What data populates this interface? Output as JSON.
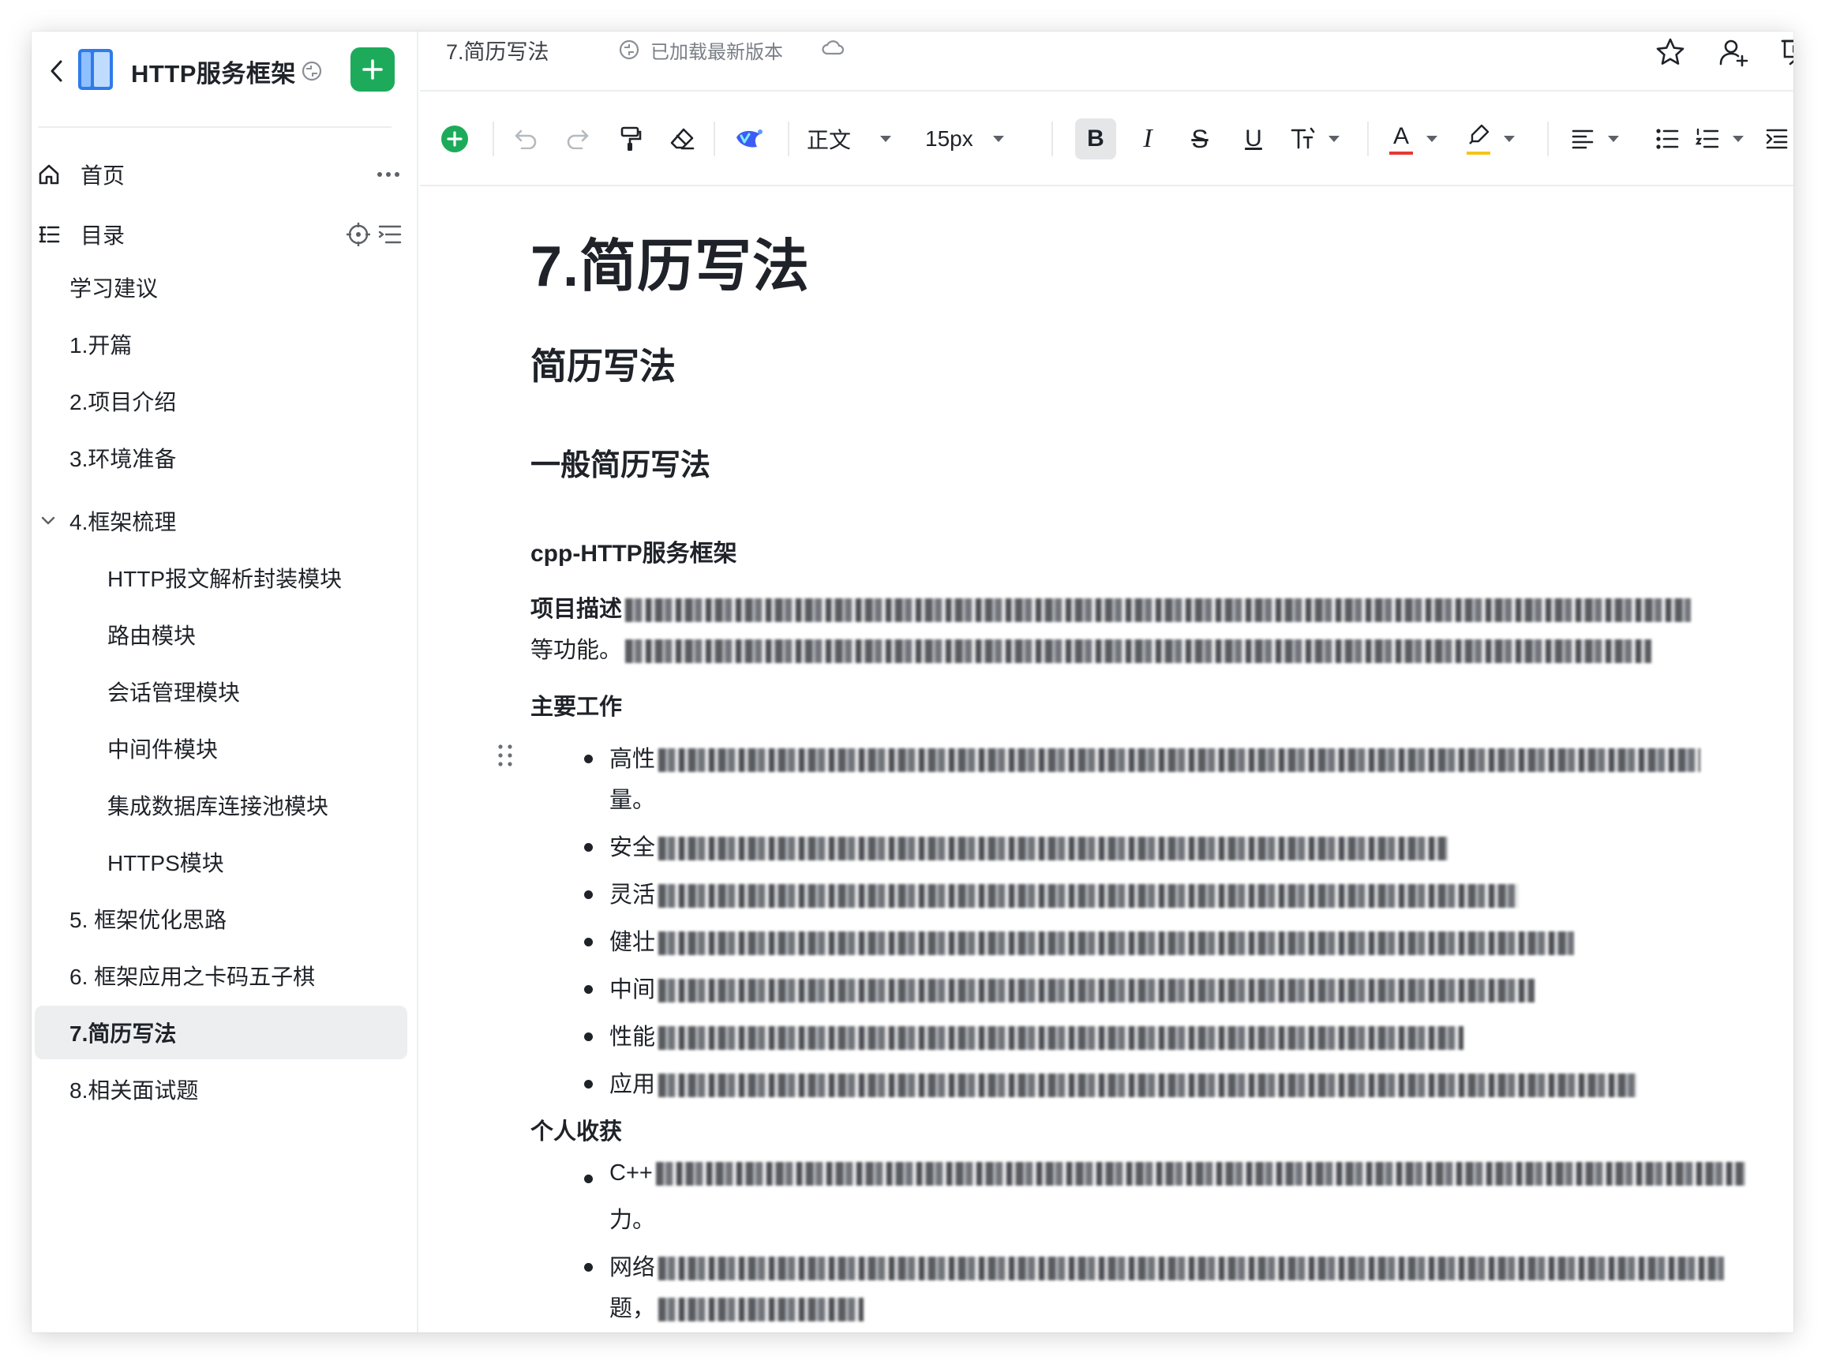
{
  "sidebar": {
    "title": "HTTP服务框架",
    "home_label": "首页",
    "toc_label": "目录",
    "items": [
      {
        "label": "学习建议"
      },
      {
        "label": "1.开篇"
      },
      {
        "label": "2.项目介绍"
      },
      {
        "label": "3.环境准备"
      },
      {
        "label": "4.框架梳理"
      },
      {
        "label": "HTTP报文解析封装模块"
      },
      {
        "label": "路由模块"
      },
      {
        "label": "会话管理模块"
      },
      {
        "label": "中间件模块"
      },
      {
        "label": "集成数据库连接池模块"
      },
      {
        "label": "HTTPS模块"
      },
      {
        "label": "5. 框架优化思路"
      },
      {
        "label": "6. 框架应用之卡码五子棋"
      },
      {
        "label": "7.简历写法"
      },
      {
        "label": "8.相关面试题"
      }
    ]
  },
  "topbar": {
    "doc_name": "7.简历写法",
    "sync_status": "已加载最新版本"
  },
  "toolbar": {
    "text_style": "正文",
    "font_size": "15px",
    "bold": "B",
    "italic": "I",
    "strike": "S",
    "underline": "U",
    "font_color_glyph": "A"
  },
  "doc": {
    "h1": "7.简历写法",
    "h2": "简历写法",
    "h3": "一般简历写法",
    "h4": "cpp-HTTP服务框架",
    "desc_label": "项目描述",
    "desc_line2_prefix": "等功能。",
    "work_label": "主要工作",
    "work_items": [
      {
        "prefix": "高性",
        "cont": "量。"
      },
      {
        "prefix": "安全"
      },
      {
        "prefix": "灵活"
      },
      {
        "prefix": "健壮"
      },
      {
        "prefix": "中间"
      },
      {
        "prefix": "性能"
      },
      {
        "prefix": "应用"
      }
    ],
    "gain_label": "个人收获",
    "gain_items": [
      {
        "prefix": "C++",
        "cont": "力。"
      },
      {
        "prefix": "网络",
        "cont": "题，"
      }
    ]
  },
  "colors": {
    "accent_green": "#1dab5b",
    "active_item_bg": "#edeeef",
    "font_color_underline": "#e53935",
    "highlight_underline": "#f5c518",
    "divider": "#eceef0"
  }
}
